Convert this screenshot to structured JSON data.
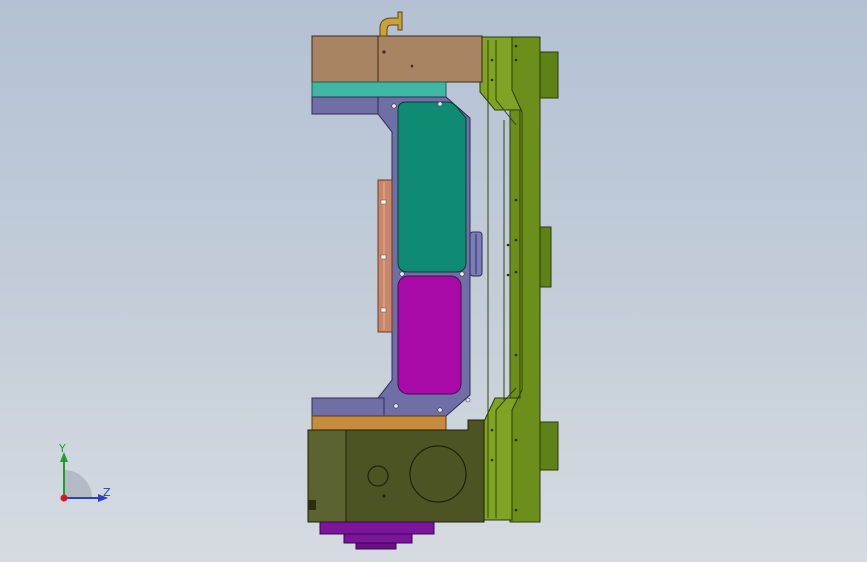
{
  "viewport": {
    "background_top": "#b4c1d4",
    "background_bottom": "#d6dbe1"
  },
  "model": {
    "colors": {
      "top_block": "#a88462",
      "teal_band": "#3fb7a2",
      "frame": "#6f6fa6",
      "teal_window": "#0f8a73",
      "magenta_window": "#a80aa8",
      "rail": "#6b8f1a",
      "base_block": "#4d5423",
      "bronze_band": "#c88a3c",
      "purple_base": "#7a159c",
      "copper_plate": "#c8876a",
      "fitting": "#c9a339"
    }
  },
  "triad": {
    "y_label": "Y",
    "z_label": "Z",
    "y_color": "#1e9e2e",
    "z_color": "#2a3ec9",
    "origin_color": "#d21b1b"
  }
}
